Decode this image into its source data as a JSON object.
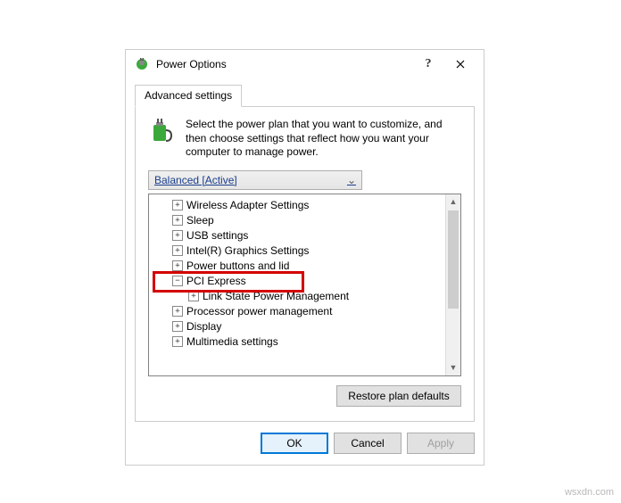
{
  "window": {
    "title": "Power Options"
  },
  "tab": {
    "label": "Advanced settings"
  },
  "description": "Select the power plan that you want to customize, and then choose settings that reflect how you want your computer to manage power.",
  "plan": {
    "selected": "Balanced [Active]"
  },
  "tree": {
    "items": [
      {
        "label": "Wireless Adapter Settings",
        "expanded": false,
        "level": 1
      },
      {
        "label": "Sleep",
        "expanded": false,
        "level": 1
      },
      {
        "label": "USB settings",
        "expanded": false,
        "level": 1
      },
      {
        "label": "Intel(R) Graphics Settings",
        "expanded": false,
        "level": 1
      },
      {
        "label": "Power buttons and lid",
        "expanded": false,
        "level": 1
      },
      {
        "label": "PCI Express",
        "expanded": true,
        "level": 1
      },
      {
        "label": "Link State Power Management",
        "expanded": false,
        "level": 2
      },
      {
        "label": "Processor power management",
        "expanded": false,
        "level": 1
      },
      {
        "label": "Display",
        "expanded": false,
        "level": 1
      },
      {
        "label": "Multimedia settings",
        "expanded": false,
        "level": 1
      }
    ]
  },
  "buttons": {
    "restore": "Restore plan defaults",
    "ok": "OK",
    "cancel": "Cancel",
    "apply": "Apply"
  },
  "watermark": "wsxdn.com"
}
